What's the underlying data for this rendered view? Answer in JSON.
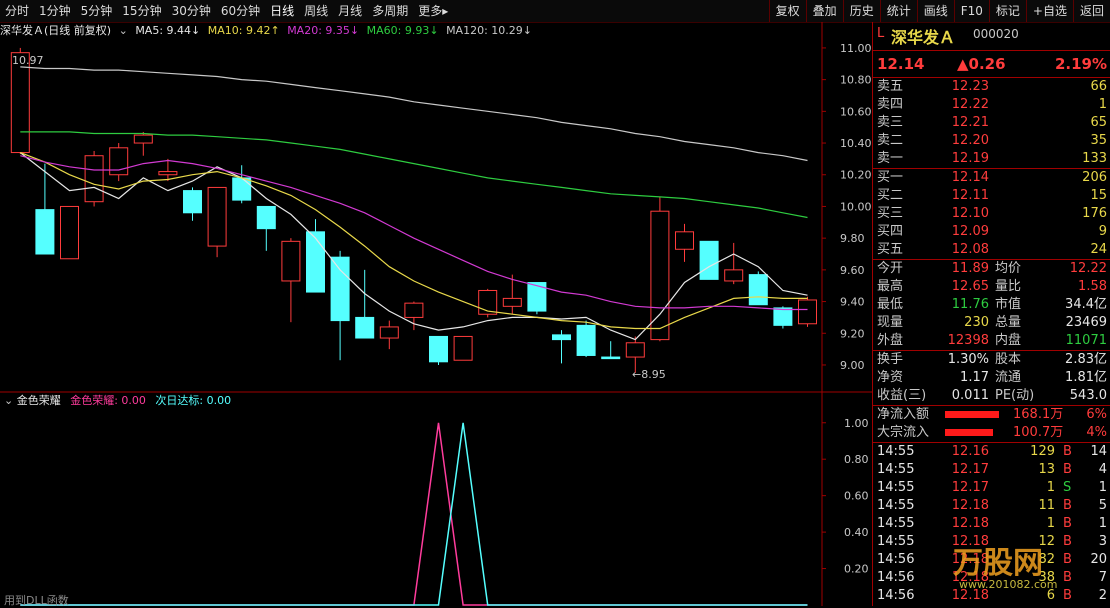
{
  "toolbar": {
    "periods": [
      "分时",
      "1分钟",
      "5分钟",
      "15分钟",
      "30分钟",
      "60分钟",
      "日线",
      "周线",
      "月线",
      "多周期",
      "更多▸"
    ],
    "active_period": "日线",
    "buttons": [
      "复权",
      "叠加",
      "历史",
      "统计",
      "画线",
      "F10",
      "标记",
      "+自选",
      "返回"
    ]
  },
  "chart_header": {
    "title": "深华发Ａ(日线 前复权)",
    "ma5": "MA5: 9.44↓",
    "ma10": "MA10: 9.42↑",
    "ma20": "MA20: 9.35↓",
    "ma60": "MA60: 9.93↓",
    "ma120": "MA120: 10.29↓",
    "high_label": "10.97",
    "low_label": "←8.95"
  },
  "colors": {
    "up": "#ff3c3c",
    "down": "#55ffff",
    "ma5": "#e6e6e6",
    "ma10": "#e8d84a",
    "ma20": "#d23ad2",
    "ma60": "#2ecc40",
    "ma120": "#c8c8c8",
    "indicator1": "#ff3c9c",
    "indicator2": "#55ffff"
  },
  "chart_data": [
    {
      "type": "candlestick",
      "title": "深华发Ａ(日线 前复权)",
      "ylim": [
        8.88,
        11.05
      ],
      "yticks": [
        "11.00",
        "10.80",
        "10.60",
        "10.40",
        "10.20",
        "10.00",
        "9.80",
        "9.60",
        "9.40",
        "9.20",
        "9.00"
      ],
      "candles": [
        {
          "o": 10.34,
          "h": 11.0,
          "l": 10.33,
          "c": 10.97
        },
        {
          "o": 9.98,
          "h": 10.27,
          "l": 9.7,
          "c": 9.7
        },
        {
          "o": 9.67,
          "h": 10.0,
          "l": 9.67,
          "c": 10.0
        },
        {
          "o": 10.03,
          "h": 10.35,
          "l": 10.0,
          "c": 10.32
        },
        {
          "o": 10.2,
          "h": 10.4,
          "l": 10.16,
          "c": 10.37
        },
        {
          "o": 10.4,
          "h": 10.47,
          "l": 10.32,
          "c": 10.45
        },
        {
          "o": 10.2,
          "h": 10.3,
          "l": 10.16,
          "c": 10.22
        },
        {
          "o": 10.1,
          "h": 10.12,
          "l": 9.91,
          "c": 9.96
        },
        {
          "o": 9.75,
          "h": 10.12,
          "l": 9.68,
          "c": 10.12
        },
        {
          "o": 10.18,
          "h": 10.26,
          "l": 10.02,
          "c": 10.04
        },
        {
          "o": 10.0,
          "h": 10.0,
          "l": 9.72,
          "c": 9.86
        },
        {
          "o": 9.53,
          "h": 9.8,
          "l": 9.27,
          "c": 9.78
        },
        {
          "o": 9.84,
          "h": 9.92,
          "l": 9.46,
          "c": 9.46
        },
        {
          "o": 9.68,
          "h": 9.72,
          "l": 9.03,
          "c": 9.28
        },
        {
          "o": 9.3,
          "h": 9.6,
          "l": 9.17,
          "c": 9.17
        },
        {
          "o": 9.17,
          "h": 9.28,
          "l": 9.1,
          "c": 9.24
        },
        {
          "o": 9.3,
          "h": 9.4,
          "l": 9.22,
          "c": 9.39
        },
        {
          "o": 9.18,
          "h": 9.18,
          "l": 9.0,
          "c": 9.02
        },
        {
          "o": 9.03,
          "h": 9.18,
          "l": 9.03,
          "c": 9.18
        },
        {
          "o": 9.32,
          "h": 9.48,
          "l": 9.3,
          "c": 9.47
        },
        {
          "o": 9.37,
          "h": 9.57,
          "l": 9.32,
          "c": 9.42
        },
        {
          "o": 9.52,
          "h": 9.52,
          "l": 9.32,
          "c": 9.34
        },
        {
          "o": 9.19,
          "h": 9.22,
          "l": 9.01,
          "c": 9.16
        },
        {
          "o": 9.25,
          "h": 9.28,
          "l": 9.05,
          "c": 9.06
        },
        {
          "o": 9.05,
          "h": 9.15,
          "l": 9.04,
          "c": 9.04
        },
        {
          "o": 9.05,
          "h": 9.18,
          "l": 8.95,
          "c": 9.14
        },
        {
          "o": 9.16,
          "h": 10.06,
          "l": 9.15,
          "c": 9.97
        },
        {
          "o": 9.73,
          "h": 9.89,
          "l": 9.65,
          "c": 9.84
        },
        {
          "o": 9.78,
          "h": 9.78,
          "l": 9.54,
          "c": 9.54
        },
        {
          "o": 9.53,
          "h": 9.77,
          "l": 9.51,
          "c": 9.6
        },
        {
          "o": 9.57,
          "h": 9.59,
          "l": 9.38,
          "c": 9.38
        },
        {
          "o": 9.36,
          "h": 9.37,
          "l": 9.23,
          "c": 9.25
        },
        {
          "o": 9.26,
          "h": 9.43,
          "l": 9.24,
          "c": 9.41
        }
      ],
      "series": [
        {
          "name": "MA5",
          "values": [
            10.34,
            10.22,
            10.1,
            10.12,
            10.05,
            10.18,
            10.1,
            10.16,
            10.25,
            10.18,
            10.05,
            9.95,
            9.8,
            9.6,
            9.45,
            9.34,
            9.26,
            9.22,
            9.24,
            9.28,
            9.3,
            9.3,
            9.29,
            9.3,
            9.22,
            9.16,
            9.32,
            9.52,
            9.62,
            9.7,
            9.62,
            9.47,
            9.44
          ]
        },
        {
          "name": "MA10",
          "values": [
            10.34,
            10.28,
            10.2,
            10.14,
            10.11,
            10.16,
            10.17,
            10.2,
            10.22,
            10.18,
            10.13,
            10.07,
            9.98,
            9.87,
            9.75,
            9.62,
            9.53,
            9.46,
            9.4,
            9.34,
            9.32,
            9.3,
            9.28,
            9.27,
            9.24,
            9.23,
            9.23,
            9.3,
            9.36,
            9.42,
            9.43,
            9.42,
            9.42
          ]
        },
        {
          "name": "MA20",
          "values": [
            10.32,
            10.28,
            10.25,
            10.23,
            10.23,
            10.27,
            10.29,
            10.27,
            10.24,
            10.2,
            10.16,
            10.12,
            10.07,
            10.02,
            9.96,
            9.88,
            9.8,
            9.73,
            9.66,
            9.59,
            9.54,
            9.5,
            9.46,
            9.44,
            9.4,
            9.37,
            9.36,
            9.36,
            9.37,
            9.37,
            9.36,
            9.35,
            9.35
          ]
        },
        {
          "name": "MA60",
          "values": [
            10.47,
            10.47,
            10.47,
            10.46,
            10.46,
            10.46,
            10.45,
            10.45,
            10.44,
            10.43,
            10.42,
            10.4,
            10.38,
            10.36,
            10.33,
            10.3,
            10.27,
            10.24,
            10.21,
            10.18,
            10.16,
            10.14,
            10.12,
            10.1,
            10.08,
            10.07,
            10.06,
            10.05,
            10.03,
            10.01,
            9.99,
            9.96,
            9.93
          ]
        },
        {
          "name": "MA120",
          "values": [
            10.88,
            10.87,
            10.87,
            10.86,
            10.86,
            10.85,
            10.84,
            10.83,
            10.82,
            10.8,
            10.79,
            10.77,
            10.75,
            10.73,
            10.71,
            10.69,
            10.66,
            10.64,
            10.62,
            10.6,
            10.58,
            10.56,
            10.53,
            10.51,
            10.49,
            10.46,
            10.44,
            10.41,
            10.39,
            10.37,
            10.34,
            10.32,
            10.29
          ]
        }
      ]
    },
    {
      "type": "line",
      "title": "金色荣耀",
      "ylim": [
        0,
        1.07
      ],
      "yticks": [
        "1.00",
        "0.80",
        "0.60",
        "0.40",
        "0.20"
      ],
      "series": [
        {
          "name": "金色荣耀",
          "values": [
            0,
            0,
            0,
            0,
            0,
            0,
            0,
            0,
            0,
            0,
            0,
            0,
            0,
            0,
            0,
            0,
            0,
            1,
            0,
            0,
            0,
            0,
            0,
            0,
            0,
            0,
            0,
            0,
            0,
            0,
            0,
            0,
            0
          ]
        },
        {
          "name": "次日达标",
          "values": [
            0,
            0,
            0,
            0,
            0,
            0,
            0,
            0,
            0,
            0,
            0,
            0,
            0,
            0,
            0,
            0,
            0,
            0,
            1,
            0,
            0,
            0,
            0,
            0,
            0,
            0,
            0,
            0,
            0,
            0,
            0,
            0,
            0
          ]
        }
      ]
    }
  ],
  "indicator_header": {
    "name": "金色荣耀",
    "v1": "金色荣耀: 0.00",
    "v2": "次日达标: 0.00",
    "footer": "用到DLL函数"
  },
  "quote": {
    "mark": "L",
    "name": "深华发Ａ",
    "code": "000020",
    "price": "12.14",
    "change": "▲0.26",
    "pct": "2.19%",
    "asks": [
      {
        "label": "卖五",
        "price": "12.23",
        "vol": "66"
      },
      {
        "label": "卖四",
        "price": "12.22",
        "vol": "1"
      },
      {
        "label": "卖三",
        "price": "12.21",
        "vol": "65"
      },
      {
        "label": "卖二",
        "price": "12.20",
        "vol": "35"
      },
      {
        "label": "卖一",
        "price": "12.19",
        "vol": "133"
      }
    ],
    "bids": [
      {
        "label": "买一",
        "price": "12.14",
        "vol": "206"
      },
      {
        "label": "买二",
        "price": "12.11",
        "vol": "15"
      },
      {
        "label": "买三",
        "price": "12.10",
        "vol": "176"
      },
      {
        "label": "买四",
        "price": "12.09",
        "vol": "9"
      },
      {
        "label": "买五",
        "price": "12.08",
        "vol": "24"
      }
    ],
    "stats1": [
      {
        "l1": "今开",
        "v1": "11.89",
        "l2": "均价",
        "v2": "12.22"
      },
      {
        "l1": "最高",
        "v1": "12.65",
        "l2": "量比",
        "v2": "1.58"
      },
      {
        "l1": "最低",
        "v1": "11.76",
        "l2": "市值",
        "v2": "34.4亿"
      },
      {
        "l1": "现量",
        "v1": "230",
        "l2": "总量",
        "v2": "23469"
      },
      {
        "l1": "外盘",
        "v1": "12398",
        "l2": "内盘",
        "v2": "11071"
      }
    ],
    "stats2": [
      {
        "l1": "换手",
        "v1": "1.30%",
        "l2": "股本",
        "v2": "2.83亿"
      },
      {
        "l1": "净资",
        "v1": "1.17",
        "l2": "流通",
        "v2": "1.81亿"
      },
      {
        "l1": "收益(三)",
        "v1": "0.011",
        "l2": "PE(动)",
        "v2": "543.0"
      }
    ],
    "flows": [
      {
        "label": "净流入额",
        "value": "168.1万",
        "pct": "6%"
      },
      {
        "label": "大宗流入",
        "value": "100.7万",
        "pct": "4%"
      }
    ],
    "ticks": [
      {
        "time": "14:55",
        "price": "12.16",
        "vol": "129",
        "bs": "B",
        "n": "14"
      },
      {
        "time": "14:55",
        "price": "12.17",
        "vol": "13",
        "bs": "B",
        "n": "4"
      },
      {
        "time": "14:55",
        "price": "12.17",
        "vol": "1",
        "bs": "S",
        "n": "1"
      },
      {
        "time": "14:55",
        "price": "12.18",
        "vol": "11",
        "bs": "B",
        "n": "5"
      },
      {
        "time": "14:55",
        "price": "12.18",
        "vol": "1",
        "bs": "B",
        "n": "1"
      },
      {
        "time": "14:55",
        "price": "12.18",
        "vol": "12",
        "bs": "B",
        "n": "3"
      },
      {
        "time": "14:56",
        "price": "12.18",
        "vol": "82",
        "bs": "B",
        "n": "20"
      },
      {
        "time": "14:56",
        "price": "12.18",
        "vol": "38",
        "bs": "B",
        "n": "7"
      },
      {
        "time": "14:56",
        "price": "12.18",
        "vol": "6",
        "bs": "B",
        "n": "2"
      }
    ],
    "watermark": "万股网",
    "watermark_url": "www.201082.com"
  }
}
